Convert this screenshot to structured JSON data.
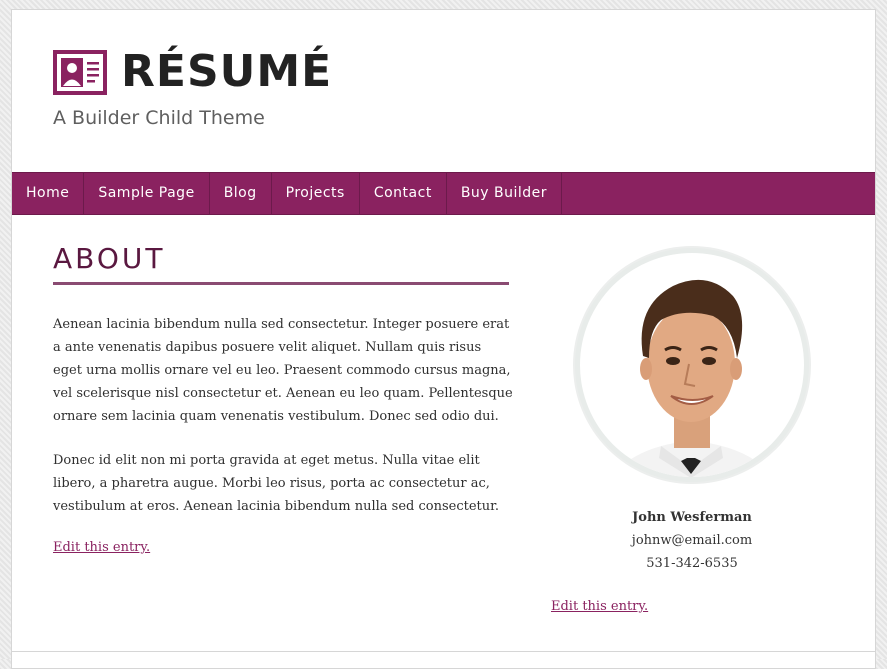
{
  "site": {
    "title": "RÉSUMÉ",
    "tagline": "A Builder Child Theme",
    "brand_color": "#8a2260",
    "logo_icon": "id-card-icon"
  },
  "nav": {
    "items": [
      {
        "label": "Home"
      },
      {
        "label": "Sample Page"
      },
      {
        "label": "Blog"
      },
      {
        "label": "Projects"
      },
      {
        "label": "Contact"
      },
      {
        "label": "Buy Builder"
      }
    ]
  },
  "main": {
    "heading": "ABOUT",
    "paragraphs": [
      "Aenean lacinia bibendum nulla sed consectetur. Integer posuere erat a ante venenatis dapibus posuere velit aliquet. Nullam quis risus eget urna mollis ornare vel eu leo. Praesent commodo cursus magna, vel scelerisque nisl consectetur et. Aenean eu leo quam. Pellentesque ornare sem lacinia quam venenatis vestibulum. Donec sed odio dui.",
      "Donec id elit non mi porta gravida at eget metus. Nulla vitae elit libero, a pharetra augue. Morbi leo risus, porta ac consectetur ac, vestibulum at eros. Aenean lacinia bibendum nulla sed consectetur."
    ],
    "edit_link": "Edit this entry."
  },
  "sidebar": {
    "name": "John Wesferman",
    "email": "johnw@email.com",
    "phone": "531-342-6535",
    "edit_link": "Edit this entry."
  }
}
